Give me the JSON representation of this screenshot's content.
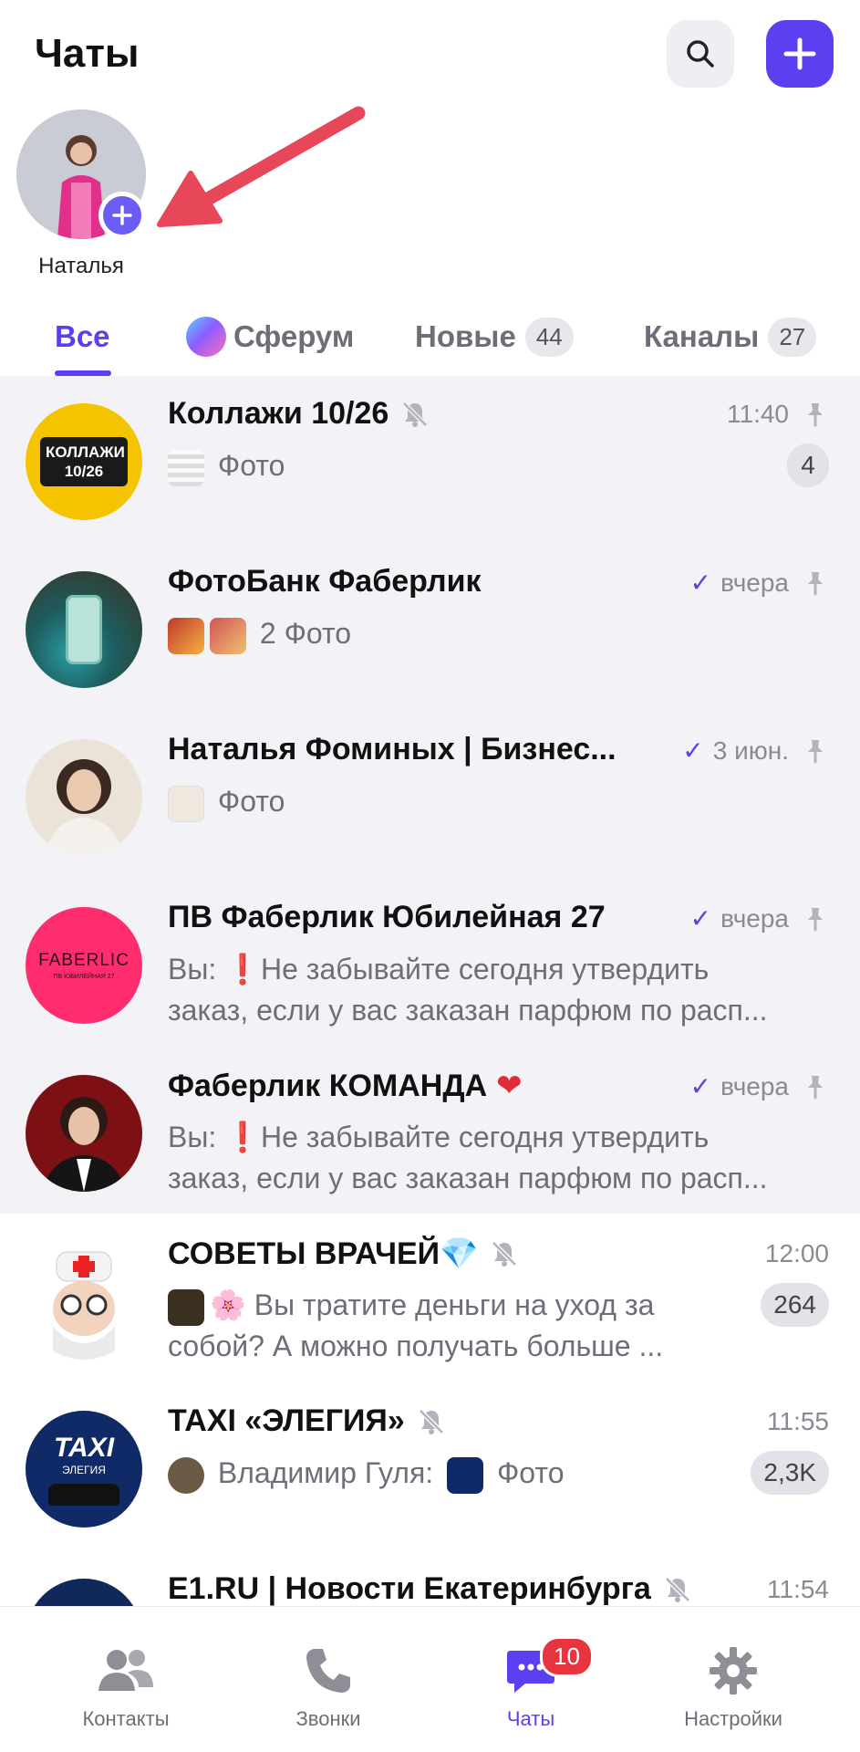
{
  "header": {
    "title": "Чаты"
  },
  "story": {
    "name": "Наталья"
  },
  "tabs": [
    {
      "label": "Все",
      "active": true
    },
    {
      "label": "Сферум"
    },
    {
      "label": "Новые",
      "badge": "44"
    },
    {
      "label": "Каналы",
      "badge": "27"
    }
  ],
  "chats": [
    {
      "name": "Коллажи 10/26",
      "time": "11:40",
      "msg_label": "Фото",
      "badge": "4",
      "avatar_text": "КОЛЛАЖИ 10/26"
    },
    {
      "name": "ФотоБанк Фаберлик",
      "time": "вчера",
      "msg_label": "2 Фото"
    },
    {
      "name": "Наталья Фоминых | Бизнес...",
      "time": "3 июн.",
      "msg_label": "Фото"
    },
    {
      "name": "ПВ Фаберлик Юбилейная 27",
      "time": "вчера",
      "sender": "Вы:",
      "msg_line1": "Не забывайте сегодня утвердить",
      "msg_line2": "заказ, если у вас заказан парфюм по расп...",
      "avatar_text": "FABERLIC",
      "avatar_sub": "ПВ ЮБИЛЕЙНАЯ 27"
    },
    {
      "name": "Фаберлик КОМАНДА",
      "time": "вчера",
      "sender": "Вы:",
      "msg_line1": "Не забывайте сегодня утвердить",
      "msg_line2": "заказ, если у вас заказан парфюм по расп..."
    },
    {
      "name": "СОВЕТЫ ВРАЧЕЙ",
      "time": "12:00",
      "msg_line1": "Вы тратите деньги на уход за",
      "msg_line2": "собой? А можно получать больше ...",
      "badge": "264"
    },
    {
      "name": "TAXI «ЭЛЕГИЯ»",
      "time": "11:55",
      "sender": "Владимир Гуля:",
      "msg_label": "Фото",
      "badge": "2,3K",
      "avatar_text": "TAXI",
      "avatar_sub": "ЭЛЕГИЯ"
    },
    {
      "name": "E1.RU | Новости Екатеринбурга",
      "time": "11:54"
    }
  ],
  "nav": [
    {
      "label": "Контакты"
    },
    {
      "label": "Звонки"
    },
    {
      "label": "Чаты",
      "badge": "10",
      "active": true
    },
    {
      "label": "Настройки"
    }
  ],
  "colors": {
    "accent": "#5b3ff0",
    "pinned_bg": "#f2f2f7",
    "badge_red": "#e8343f",
    "arrow": "#e8475a"
  }
}
